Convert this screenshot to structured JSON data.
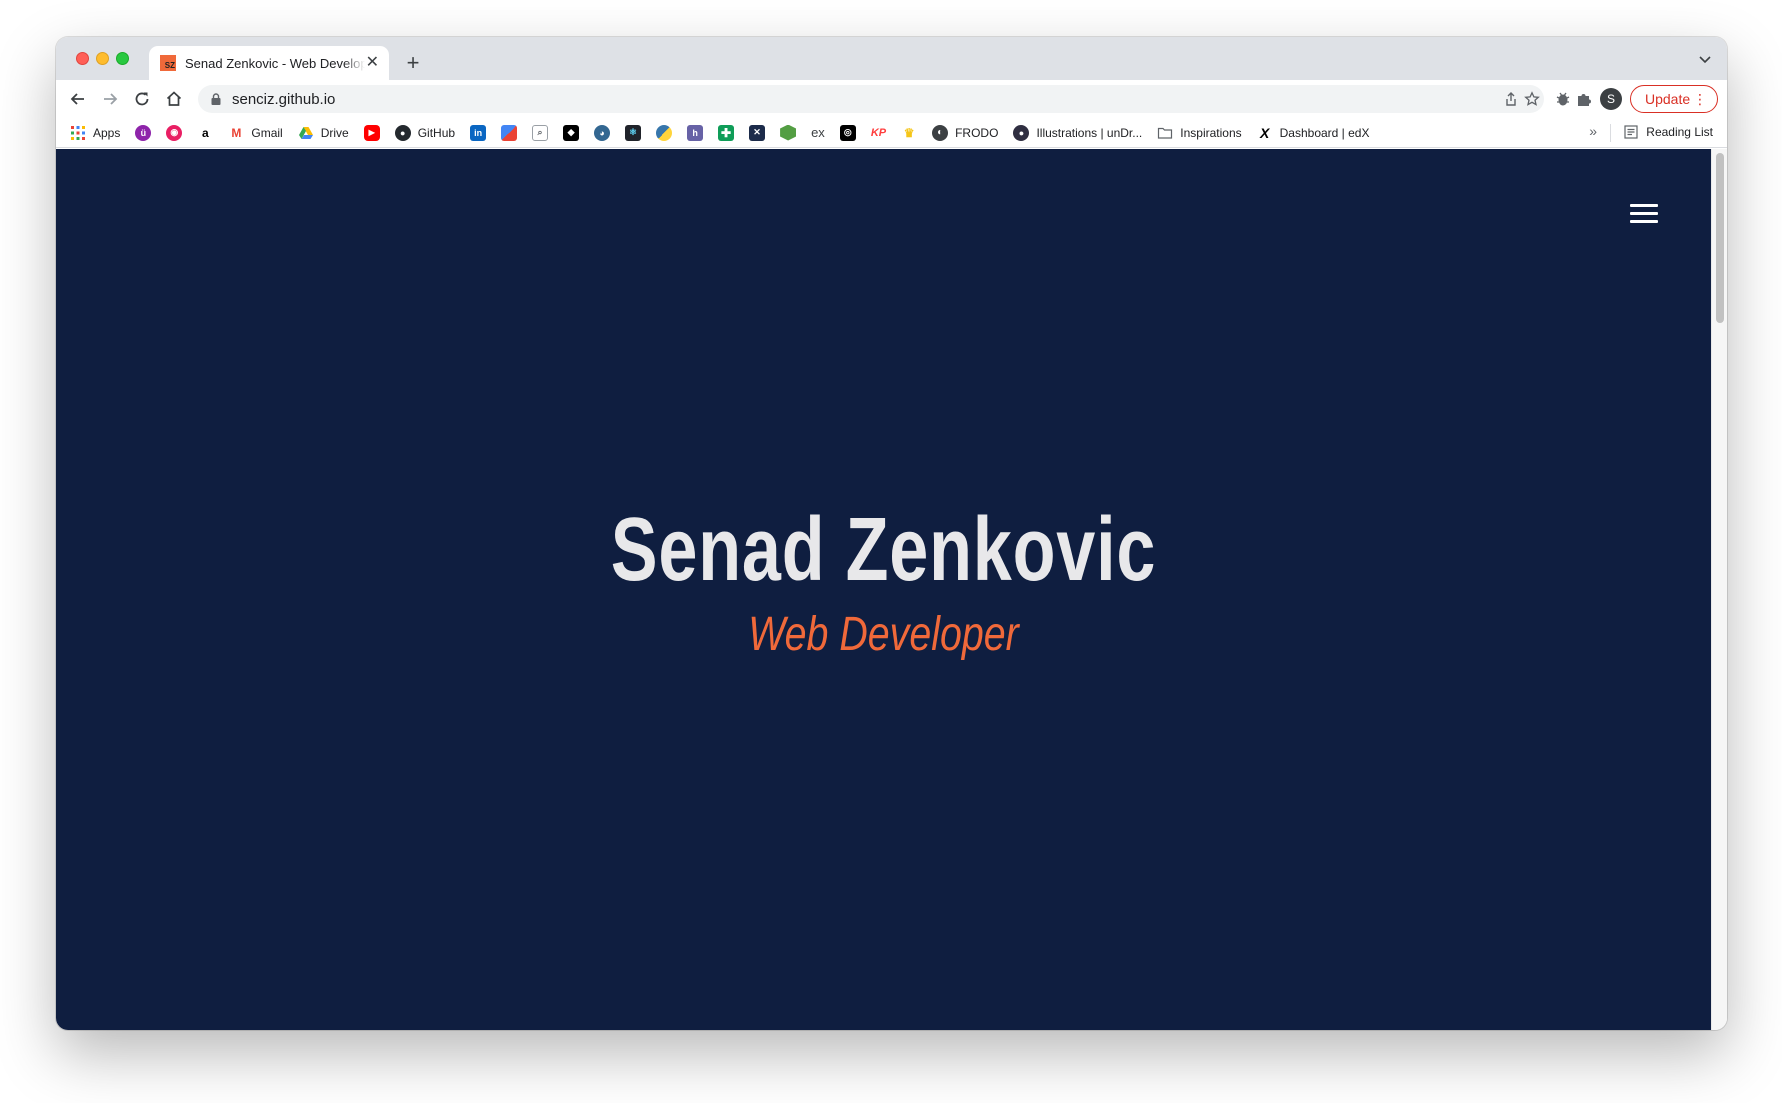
{
  "tab": {
    "title": "Senad Zenkovic - Web Developer",
    "favicon_text": "SZ"
  },
  "toolbar": {
    "url": "senciz.github.io",
    "update_label": "Update",
    "profile_initial": "S"
  },
  "bookmarks": {
    "apps": "Apps",
    "gmail": "Gmail",
    "drive": "Drive",
    "github": "GitHub",
    "ex": "ex",
    "kp": "KP",
    "frodo": "FRODO",
    "illustrations": "Illustrations | unDr...",
    "inspirations": "Inspirations",
    "edx": "Dashboard | edX",
    "reading_list": "Reading List"
  },
  "page": {
    "name": "Senad Zenkovic",
    "role": "Web Developer"
  },
  "colors": {
    "page_bg": "#0f1e40",
    "accent": "#f0693a",
    "name_text": "#e8e8ea"
  }
}
